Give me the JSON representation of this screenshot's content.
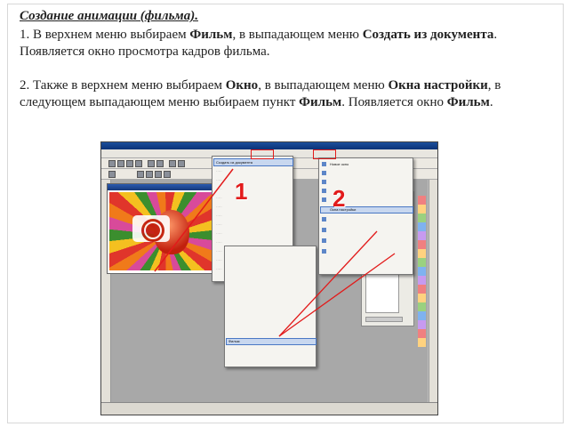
{
  "slide": {
    "heading": "Создание анимации (фильма).",
    "p1": {
      "a": "1. В верхнем меню выбираем ",
      "b": "Фильм",
      "c": ", в выпадающем меню ",
      "d": "Создать из документа",
      "e": ". Появляется окно просмотра кадров фильма."
    },
    "p2": {
      "a": "2. Также в верхнем меню выбираем ",
      "b": "Окно",
      "c": ", в выпадающем меню ",
      "d": "Окна настройки",
      "e": ", в следующем выпадающем меню выбираем пункт ",
      "f": "Фильм",
      "g": ". Появляется окно ",
      "h": "Фильм",
      "i": "."
    }
  },
  "screenshot": {
    "annotation_1": "1",
    "annotation_2": "2",
    "annotation_color": "#e21b1b",
    "menu1_first_item": "Создать из документа",
    "menu2_highlight_item": "Фильм",
    "menu3_highlight_item": "Окна настройки",
    "menu3_first_item": "Новое окно"
  }
}
